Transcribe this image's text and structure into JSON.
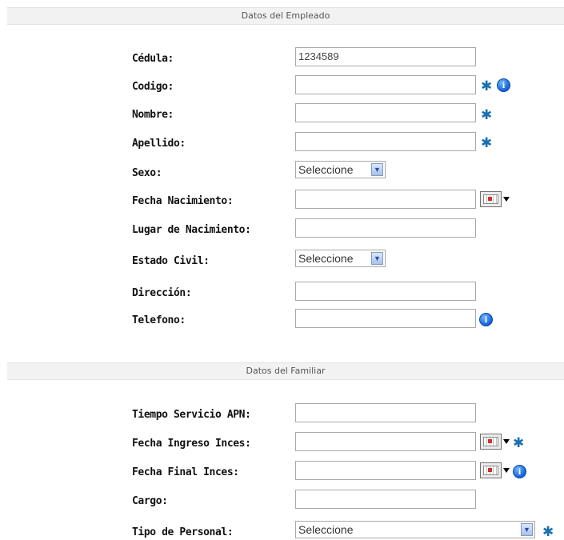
{
  "sections": {
    "empleado": "Datos del Empleado",
    "familiar": "Datos del Familiar"
  },
  "empleado": {
    "cedula_label": "Cédula:",
    "cedula_value": "1234589",
    "codigo_label": "Codigo:",
    "nombre_label": "Nombre:",
    "apellido_label": "Apellido:",
    "sexo_label": "Sexo:",
    "sexo_value": "Seleccione",
    "fecha_nacimiento_label": "Fecha Nacimiento:",
    "lugar_nacimiento_label": "Lugar de Nacimiento:",
    "estado_civil_label": "Estado Civil:",
    "estado_civil_value": "Seleccione",
    "direccion_label": "Dirección:",
    "telefono_label": "Telefono:"
  },
  "familiar": {
    "tiempo_servicio_label": "Tiempo Servicio APN:",
    "fecha_ingreso_label": "Fecha Ingreso Inces:",
    "fecha_final_label": "Fecha Final Inces:",
    "cargo_label": "Cargo:",
    "tipo_personal_label": "Tipo de Personal:",
    "tipo_personal_value": "Seleccione"
  },
  "icons": {
    "required": "asterisk-icon",
    "info": "info-icon",
    "calendar": "calendar-icon"
  },
  "colors": {
    "header_bg": "#f2f2f2",
    "info_blue": "#1463d8",
    "required_blue": "#1a6fb0"
  }
}
